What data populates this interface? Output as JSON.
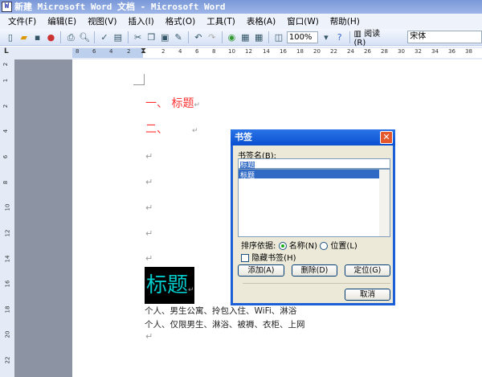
{
  "window": {
    "title": "新建 Microsoft Word 文档 - Microsoft Word"
  },
  "menu": [
    "文件(F)",
    "编辑(E)",
    "视图(V)",
    "插入(I)",
    "格式(O)",
    "工具(T)",
    "表格(A)",
    "窗口(W)",
    "帮助(H)"
  ],
  "toolbar": {
    "zoom": "100%",
    "read": "阅读(R)",
    "font": "宋体"
  },
  "ruler": {
    "h": [
      "8",
      "6",
      "4",
      "2",
      "2",
      "4",
      "6",
      "8",
      "10",
      "12",
      "14",
      "16",
      "18",
      "20",
      "22",
      "24",
      "26",
      "28",
      "30",
      "32",
      "34",
      "36",
      "38"
    ],
    "v": [
      "2",
      "1",
      "2",
      "4",
      "6",
      "8",
      "10",
      "12",
      "14",
      "16",
      "18",
      "20",
      "22"
    ]
  },
  "document": {
    "heading1": "一、 标题",
    "heading2": "二、",
    "boxed": "标题",
    "line1": "个人、男生公寓、拎包入住、WiFi、淋浴",
    "line2": "个人、仅限男生、淋浴、被褥、衣柜、上网",
    "mark": "↵"
  },
  "dialog": {
    "title": "书签",
    "name_label": "书签名(B):",
    "name_value": "标题",
    "list_items": [
      "标题"
    ],
    "sort_label": "排序依据:",
    "sort_name": "名称(N)",
    "sort_position": "位置(L)",
    "sort_selected": "名称",
    "hidden_label": "隐藏书签(H)",
    "hidden_checked": false,
    "add": "添加(A)",
    "delete": "删除(D)",
    "goto": "定位(G)",
    "cancel": "取消"
  }
}
